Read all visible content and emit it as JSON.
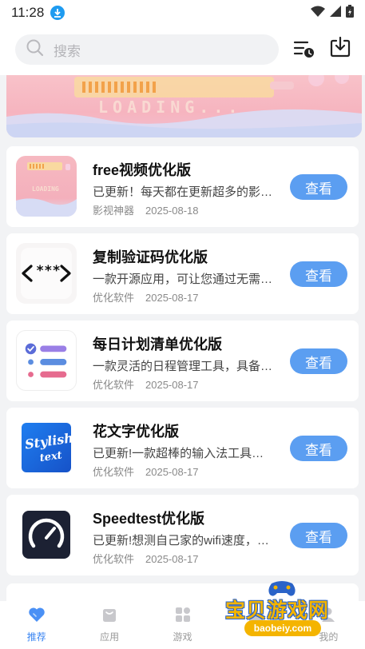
{
  "status_bar": {
    "time": "11:28"
  },
  "search": {
    "placeholder": "搜索"
  },
  "banner": {
    "text": "LOADING..."
  },
  "apps": [
    {
      "name": "free视频优化版",
      "desc": "已更新！每天都在更新超多的影视资源",
      "category": "影视神器",
      "date": "2025-08-18",
      "button": "查看",
      "icon": "loading-banner-icon"
    },
    {
      "name": "复制验证码优化版",
      "desc": "一款开源应用，可让您通过无需手动复制",
      "category": "优化软件",
      "date": "2025-08-17",
      "button": "查看",
      "icon": "code-brackets-icon"
    },
    {
      "name": "每日计划清单优化版",
      "desc": "一款灵活的日程管理工具，具备多种功能",
      "category": "优化软件",
      "date": "2025-08-17",
      "button": "查看",
      "icon": "checklist-icon"
    },
    {
      "name": "花文字优化版",
      "desc": "已更新!一款超棒的输入法工具，可以生成",
      "category": "优化软件",
      "date": "2025-08-17",
      "button": "查看",
      "icon": "stylish-text-icon"
    },
    {
      "name": "Speedtest优化版",
      "desc": "已更新!想测自己家的wifi速度，可以试试",
      "category": "优化软件",
      "date": "2025-08-17",
      "button": "查看",
      "icon": "speedometer-icon"
    }
  ],
  "tabs": [
    {
      "label": "推荐",
      "icon": "heart-icon",
      "active": true
    },
    {
      "label": "应用",
      "icon": "bag-icon",
      "active": false
    },
    {
      "label": "游戏",
      "icon": "grid-icon",
      "active": false
    },
    {
      "label": "",
      "icon": "list-icon",
      "active": false
    },
    {
      "label": "我的",
      "icon": "person-icon",
      "active": false
    }
  ],
  "watermark": {
    "title": "宝贝游戏网",
    "url": "baobeiy.com"
  },
  "colors": {
    "accent": "#5b9ef1",
    "tab_active": "#3b86f2",
    "banner": "#f6b4bf"
  }
}
